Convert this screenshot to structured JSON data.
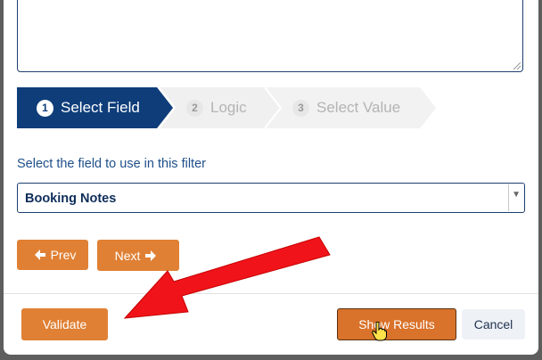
{
  "wizard": {
    "steps": [
      {
        "number": "1",
        "label": "Select Field",
        "state": "active"
      },
      {
        "number": "2",
        "label": "Logic",
        "state": "inactive"
      },
      {
        "number": "3",
        "label": "Select Value",
        "state": "inactive"
      }
    ],
    "active_color": "#0e3d7a",
    "inactive_color": "#f2f2f2"
  },
  "field": {
    "label": "Select the field to use in this filter",
    "selected_value": "Booking Notes"
  },
  "nav": {
    "prev_label": "Prev",
    "next_label": "Next"
  },
  "footer": {
    "validate_label": "Validate",
    "show_results_label": "Show Results",
    "cancel_label": "Cancel"
  },
  "colors": {
    "accent_orange": "#e08034",
    "annotation_arrow": "#f0141a"
  },
  "icons": {
    "prev": "arrow-left-icon",
    "next": "arrow-right-icon",
    "dropdown": "caret-down-icon",
    "cursor": "hand-pointer-icon"
  }
}
